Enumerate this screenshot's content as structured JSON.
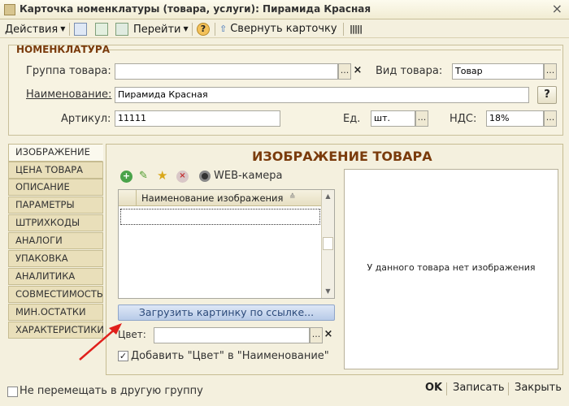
{
  "window": {
    "title": "Карточка номенклатуры (товара, услуги): Пирамида Красная",
    "close_glyph": "×"
  },
  "toolbar": {
    "actions_label": "Действия",
    "goto_label": "Перейти",
    "help_glyph": "?",
    "collapse_label": "Свернуть карточку"
  },
  "group": {
    "title": "НОМЕНКЛАТУРА",
    "product_group_label": "Группа товара:",
    "product_group_value": "",
    "product_kind_label": "Вид товара:",
    "product_kind_value": "Товар",
    "name_label": "Наименование:",
    "name_value": "Пирамида Красная",
    "sku_label": "Артикул:",
    "sku_value": "11111",
    "unit_label": "Ед.",
    "unit_value": "шт.",
    "vat_label": "НДС:",
    "vat_value": "18%",
    "help_glyph": "?",
    "dots_glyph": "...",
    "clear_glyph": "×"
  },
  "tabs": [
    {
      "label": "ИЗОБРАЖЕНИЕ",
      "active": true
    },
    {
      "label": "ЦЕНА ТОВАРА",
      "active": false
    },
    {
      "label": "ОПИСАНИЕ",
      "active": false
    },
    {
      "label": "ПАРАМЕТРЫ",
      "active": false
    },
    {
      "label": "ШТРИХКОДЫ",
      "active": false
    },
    {
      "label": "АНАЛОГИ",
      "active": false
    },
    {
      "label": "УПАКОВКА",
      "active": false
    },
    {
      "label": "АНАЛИТИКА",
      "active": false
    },
    {
      "label": "СОВМЕСТИМОСТЬ",
      "active": false
    },
    {
      "label": "МИН.ОСТАТКИ",
      "active": false
    },
    {
      "label": "ХАРАКТЕРИСТИКИ",
      "active": false
    }
  ],
  "image_panel": {
    "title": "ИЗОБРАЖЕНИЕ ТОВАРА",
    "webcam_label": "WEB-камера",
    "grid_header": "Наименование изображения",
    "load_button_label": "Загрузить картинку по ссылке...",
    "color_label": "Цвет:",
    "color_value": "",
    "add_color_label": "Добавить \"Цвет\" в \"Наименование\"",
    "add_color_checked": true,
    "no_image_text": "У данного товара нет изображения",
    "checkmark_glyph": "✓"
  },
  "footer": {
    "no_move_label": "Не перемещать в другую группу",
    "no_move_checked": false,
    "ok_label": "OK",
    "save_label": "Записать",
    "close_label": "Закрыть"
  },
  "colors": {
    "background": "#f4f0de",
    "accent_title": "#7a3b0c",
    "annotation_arrow": "#e0201b"
  }
}
